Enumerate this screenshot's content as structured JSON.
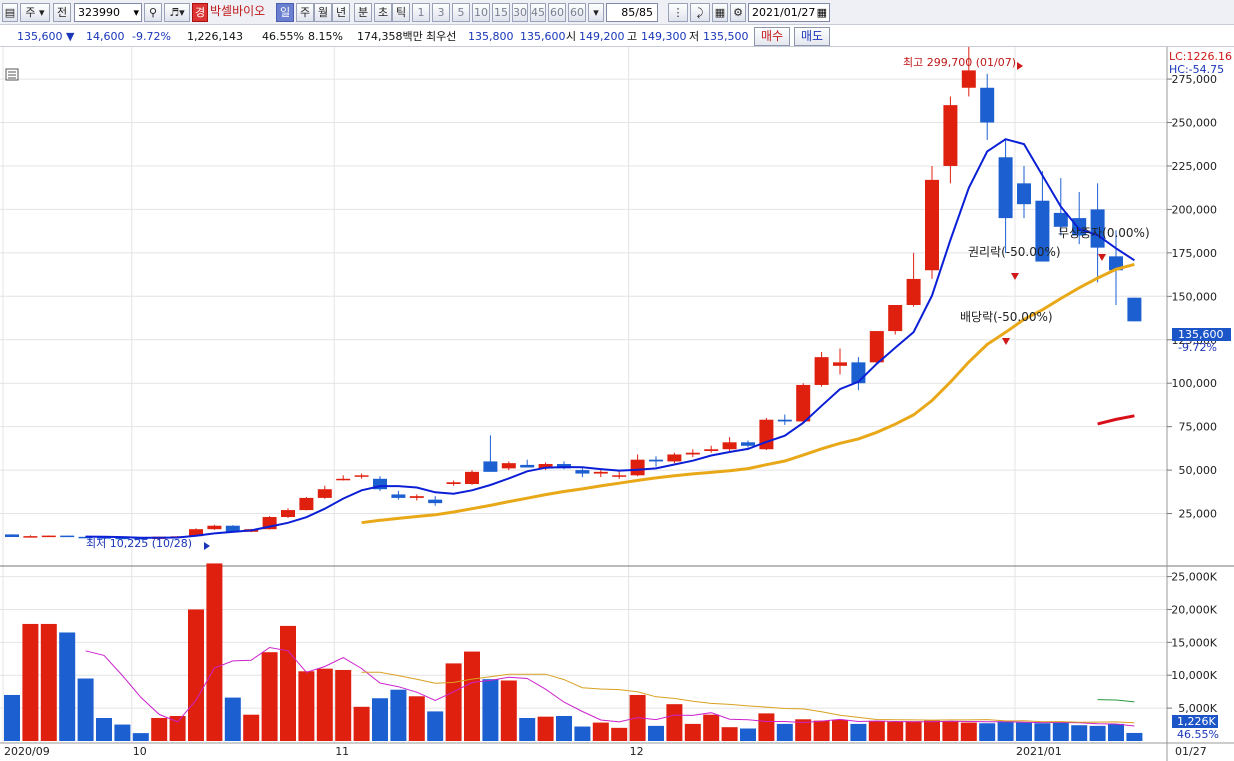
{
  "toolbar": {
    "market": "주",
    "prev_label": "전",
    "code": "323990",
    "badge": "경",
    "stock_name": "박셀바이오",
    "periods": [
      "일",
      "주",
      "월",
      "년",
      "분",
      "초",
      "틱"
    ],
    "selected_period": "일",
    "intervals": [
      "1",
      "3",
      "5",
      "10",
      "15",
      "30",
      "45",
      "60",
      "60"
    ],
    "page": "85/85",
    "date": "2021/01/27"
  },
  "info": {
    "price": "135,600",
    "change": "14,600",
    "change_pct": "-9.72%",
    "volume": "1,226,143",
    "vol_ratio": "46.55%",
    "turnover": "8.15%",
    "amount": "174,358백만",
    "best_label": "최우선",
    "best_ask": "135,800",
    "best_bid": "135,600",
    "open_label": "시",
    "open": "149,200",
    "high_label": "고",
    "high": "149,300",
    "low_label": "저",
    "low": "135,500",
    "buy": "매수",
    "sell": "매도"
  },
  "annotations": {
    "lc": "LC:1226.16",
    "hc": "HC:-54.75",
    "high_note": "최고 299,700 (01/07)",
    "low_note": "최저 10,225 (10/28)",
    "rights_cut": "권리락(-50.00%)",
    "dividend_cut": "배당락(-50.00%)",
    "other_cut": "무상증자(0.00%)",
    "price_tag": "135,600",
    "price_pct": "-9.72%",
    "vol_tag": "1,226K",
    "vol_pct": "46.55%"
  },
  "colors": {
    "up": "#e0200f",
    "down": "#1c5fd1",
    "ma_short": "#0b1fd6",
    "ma_mid": "#e8a818",
    "ma_long": "#d8101a",
    "vol_ma_short": "#cc22cc",
    "vol_ma_mid": "#d8a020",
    "vol_ma_long": "#2a9a3a"
  },
  "chart_data": {
    "type": "candlestick",
    "price_axis": {
      "min": 0,
      "max": 290000,
      "ticks": [
        25000,
        50000,
        75000,
        100000,
        125000,
        150000,
        175000,
        200000,
        225000,
        250000,
        275000
      ]
    },
    "price_tick_labels": [
      "25,000",
      "50,000",
      "75,000",
      "100,000",
      "125,000",
      "150,000",
      "175,000",
      "200,000",
      "225,000",
      "250,000",
      "275,000"
    ],
    "volume_axis": {
      "min": 0,
      "max": 26000,
      "ticks": [
        5000,
        10000,
        15000,
        20000,
        25000
      ]
    },
    "volume_tick_labels": [
      "5,000K",
      "10,000K",
      "15,000K",
      "20,000K",
      "25,000K"
    ],
    "x_labels": [
      {
        "i": 0,
        "label": "2020/09"
      },
      {
        "i": 7,
        "label": "10"
      },
      {
        "i": 18,
        "label": "11"
      },
      {
        "i": 34,
        "label": "12"
      },
      {
        "i": 55,
        "label": "2021/01"
      }
    ],
    "last_date": "01/27",
    "candles": [
      [
        13000,
        13000,
        11500,
        11500,
        7000
      ],
      [
        12000,
        12500,
        11800,
        12000,
        17800
      ],
      [
        12000,
        12400,
        11800,
        12300,
        17800
      ],
      [
        12300,
        12300,
        11500,
        11600,
        16500
      ],
      [
        11600,
        11800,
        11200,
        11400,
        9500
      ],
      [
        11400,
        11400,
        11000,
        11100,
        3500
      ],
      [
        11100,
        11200,
        10800,
        10900,
        2500
      ],
      [
        10900,
        11000,
        10225,
        10400,
        1200
      ],
      [
        10400,
        11800,
        10300,
        11700,
        3500
      ],
      [
        11700,
        12000,
        11600,
        11900,
        3800
      ],
      [
        12000,
        16500,
        11900,
        16000,
        20000
      ],
      [
        16000,
        18500,
        15600,
        18000,
        27000
      ],
      [
        18000,
        18300,
        14400,
        14500,
        6600
      ],
      [
        14500,
        16200,
        14300,
        16000,
        4000
      ],
      [
        16000,
        23500,
        15800,
        23000,
        13500
      ],
      [
        23000,
        28000,
        22500,
        27000,
        17500
      ],
      [
        27000,
        34500,
        26800,
        34000,
        10600
      ],
      [
        34000,
        41000,
        33500,
        39000,
        11000
      ],
      [
        45000,
        47000,
        44000,
        45000,
        10800
      ],
      [
        47000,
        48000,
        45000,
        47000,
        5200
      ],
      [
        45000,
        46500,
        38000,
        39000,
        6500
      ],
      [
        36000,
        38000,
        33000,
        34000,
        7800
      ],
      [
        34000,
        36000,
        32500,
        35000,
        6800
      ],
      [
        33000,
        35000,
        29500,
        31000,
        4500
      ],
      [
        42000,
        44000,
        41000,
        43000,
        11800
      ],
      [
        42000,
        50000,
        41500,
        49000,
        13600
      ],
      [
        55000,
        70000,
        53000,
        49000,
        9400
      ],
      [
        51000,
        55000,
        50000,
        54000,
        9200
      ],
      [
        53000,
        56000,
        51500,
        51500,
        3500
      ],
      [
        51000,
        54500,
        50000,
        53500,
        3700
      ],
      [
        53500,
        55000,
        50500,
        51000,
        3800
      ],
      [
        50000,
        51000,
        46000,
        48000,
        2200
      ],
      [
        48000,
        50000,
        46000,
        49000,
        2800
      ],
      [
        46500,
        50000,
        45000,
        47000,
        2000
      ],
      [
        47000,
        59000,
        46500,
        56000,
        7000
      ],
      [
        56000,
        58000,
        52000,
        55000,
        2300
      ],
      [
        55000,
        60000,
        54000,
        59000,
        5600
      ],
      [
        59000,
        62000,
        57500,
        60000,
        2600
      ],
      [
        61000,
        64000,
        60000,
        62000,
        4000
      ],
      [
        62000,
        69000,
        61000,
        66000,
        2100
      ],
      [
        66000,
        67000,
        63000,
        64000,
        1900
      ],
      [
        62000,
        80000,
        61500,
        79000,
        4200
      ],
      [
        79000,
        82000,
        76000,
        78000,
        2600
      ],
      [
        78000,
        100000,
        77000,
        99000,
        3300
      ],
      [
        99000,
        118000,
        98000,
        115000,
        3100
      ],
      [
        110000,
        120000,
        105000,
        112000,
        3200
      ],
      [
        112000,
        115000,
        96000,
        100000,
        2600
      ],
      [
        112000,
        125000,
        111000,
        130000,
        3000
      ],
      [
        130000,
        145000,
        128000,
        145000,
        2900
      ],
      [
        145000,
        175000,
        144000,
        160000,
        3000
      ],
      [
        165000,
        225000,
        160000,
        217000,
        3100
      ],
      [
        225000,
        265000,
        215000,
        260000,
        3000
      ],
      [
        270000,
        299700,
        265000,
        280000,
        2800
      ],
      [
        270000,
        278000,
        240000,
        250000,
        2700
      ],
      [
        230000,
        240000,
        175000,
        195000,
        3000
      ],
      [
        215000,
        225000,
        195000,
        203000,
        2800
      ],
      [
        205000,
        222000,
        170000,
        170000,
        2700
      ],
      [
        198000,
        218000,
        185000,
        190000,
        2900
      ],
      [
        195000,
        210000,
        180000,
        185000,
        2400
      ],
      [
        200000,
        215000,
        158000,
        178000,
        2300
      ],
      [
        173000,
        188000,
        145000,
        165000,
        2600
      ],
      [
        149200,
        149300,
        135500,
        135600,
        1226
      ]
    ]
  }
}
